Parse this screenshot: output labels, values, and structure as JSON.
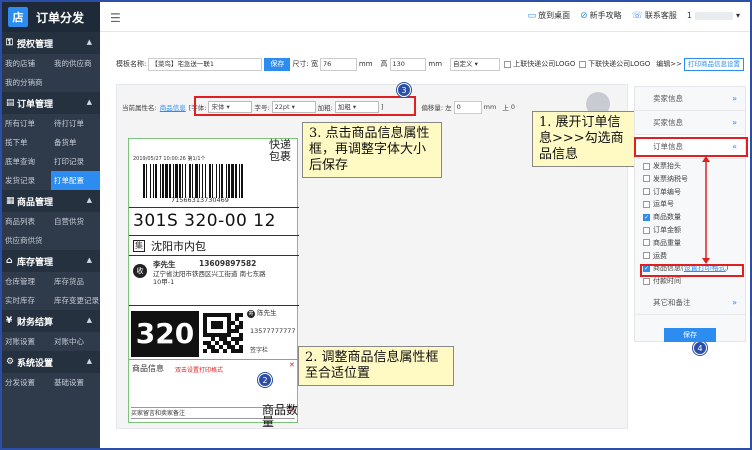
{
  "app": {
    "logo_char": "店",
    "title": "订单分发"
  },
  "sidebar": {
    "groups": [
      {
        "icon": "key-icon",
        "glyph": "⚿",
        "label": "授权管理",
        "rows": [
          [
            "我的店铺",
            "我的供应商"
          ],
          [
            "我的分销商",
            ""
          ]
        ]
      },
      {
        "icon": "document-icon",
        "glyph": "▤",
        "label": "订单管理",
        "rows": [
          [
            "所有订单",
            "待打订单"
          ],
          [
            "揽下单",
            "备货单"
          ],
          [
            "底单查询",
            "打印记录"
          ],
          [
            "发货记录",
            "打单配置"
          ]
        ]
      },
      {
        "icon": "grid-icon",
        "glyph": "▦",
        "label": "商品管理",
        "rows": [
          [
            "商品列表",
            "自营供货"
          ],
          [
            "供应商供货",
            ""
          ]
        ]
      },
      {
        "icon": "home-icon",
        "glyph": "⌂",
        "label": "库存管理",
        "rows": [
          [
            "仓库管理",
            "库存货品"
          ],
          [
            "实时库存",
            "库存变更记录"
          ]
        ]
      },
      {
        "icon": "yen-icon",
        "glyph": "¥",
        "label": "财务结算",
        "rows": [
          [
            "对账设置",
            "对账中心"
          ]
        ]
      },
      {
        "icon": "settings-icon",
        "glyph": "⚙",
        "label": "系统设置",
        "rows": [
          [
            "分发设置",
            "基础设置"
          ]
        ]
      }
    ],
    "active_item": "打单配置"
  },
  "topbar": {
    "links": [
      {
        "icon": "desktop-icon",
        "glyph": "▭",
        "label": "放到桌面"
      },
      {
        "icon": "guide-icon",
        "glyph": "⊘",
        "label": "新手攻略"
      },
      {
        "icon": "support-icon",
        "glyph": "☏",
        "label": "联系客服"
      }
    ],
    "user": "1",
    "user_caret": "▾"
  },
  "template_bar": {
    "name_label": "模板名称:",
    "name_value": "【菜鸟】宅急送一联1",
    "save": "保存",
    "size_label": "尺寸: 宽",
    "width": "76",
    "unit1": "mm",
    "height_label": "高",
    "height": "130",
    "unit2": "mm",
    "custom": "自定义",
    "upper_logo": "上联快递公司LOGO",
    "lower_logo": "下联快递公司LOGO",
    "edit": "编辑",
    "edit_arrow": ">>",
    "print_setting": "打印商品信息设置"
  },
  "attr_bar": {
    "current_label": "当前属性名:",
    "current_value": "商品信息",
    "font_label": "[字体:",
    "font_value": "宋体",
    "size_label": "字号:",
    "size_value": "22pt",
    "bold_label": "加粗:",
    "bold_value": "加粗",
    "close_bracket": "]",
    "offset_label": "偏移量: 左",
    "offset_value": "0",
    "offset_unit": "mm",
    "top_label": "上",
    "top_value": "0"
  },
  "label": {
    "date": "2019/05/27  10:00:26  第1/1个",
    "express": "快递包裹",
    "barcode_num": "71566313730469",
    "big_code": "301S 320-00 12",
    "ji": "集",
    "bag": "沈阳市内包",
    "shou": "收",
    "recv_name": "李先生",
    "recv_phone": "13609897582",
    "recv_addr": "辽宁省沈阳市铁西区兴工街道 南七东路10甲-1",
    "big_num": "320",
    "ji_small": "寄",
    "sender": "陈先生",
    "sender_phone": "13577777777",
    "sign": "签字栏",
    "prod_label": "商品信息",
    "prod_hint": "双击设置打印格式",
    "remarks": "买家留言和卖家备注",
    "overlay": "商品数量"
  },
  "callouts": {
    "c1": "1. 展开订单信息>>>勾选商品信息",
    "c2": "2. 调整商品信息属性框至合适位置",
    "c3": "3. 点击商品信息属性框，再调整字体大小后保存",
    "n1": "1",
    "n2": "2",
    "n3": "3",
    "n4": "4"
  },
  "right_panel": {
    "sections": [
      "卖家信息",
      "买家信息",
      "订单信息",
      "其它和备注"
    ],
    "options": [
      {
        "label": "发票抬头",
        "checked": false
      },
      {
        "label": "发票纳税号",
        "checked": false
      },
      {
        "label": "订单编号",
        "checked": false
      },
      {
        "label": "运单号",
        "checked": false
      },
      {
        "label": "商品数量",
        "checked": true
      },
      {
        "label": "订单金额",
        "checked": false
      },
      {
        "label": "商品重量",
        "checked": false
      },
      {
        "label": "运费",
        "checked": false
      },
      {
        "label": "商品信息(",
        "link": "设置打印格式",
        "end": ")",
        "checked": true
      },
      {
        "label": "付款时间",
        "checked": false
      }
    ],
    "save": "保存"
  },
  "colors": {
    "primary": "#2d8cf0",
    "sidebar": "#2f3a4a",
    "highlight": "#e02020",
    "callout": "#fff9c4"
  }
}
